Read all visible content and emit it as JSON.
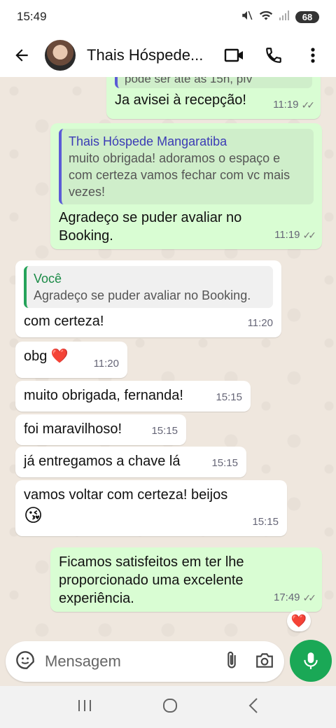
{
  "status": {
    "time": "15:49",
    "battery": "68"
  },
  "header": {
    "contact_name": "Thais Hóspede..."
  },
  "messages": [
    {
      "type": "out",
      "partial_text": "pode ser até às 15h, pfv",
      "text": "Ja avisei à recepção!",
      "time": "11:19"
    },
    {
      "type": "out",
      "quote_name": "Thais Hóspede Mangaratiba",
      "quote_text": "muito obrigada! adoramos o espaço e com certeza vamos fechar com vc mais vezes!",
      "text": "Agradeço se puder avaliar no Booking.",
      "time": "11:19"
    },
    {
      "type": "in",
      "quote_name": "Você",
      "quote_text": "Agradeço se puder avaliar no Booking.",
      "text": "com certeza!",
      "time": "11:20"
    },
    {
      "type": "in",
      "text": "obg ❤️",
      "time": "11:20"
    },
    {
      "type": "in",
      "text": "muito obrigada, fernanda!",
      "time": "15:15"
    },
    {
      "type": "in",
      "text": "foi maravilhoso!",
      "time": "15:15"
    },
    {
      "type": "in",
      "text": "já entregamos a chave lá",
      "time": "15:15"
    },
    {
      "type": "in",
      "text": "vamos voltar com certeza! beijos",
      "emoji": "😘",
      "time": "15:15"
    },
    {
      "type": "out",
      "text": "Ficamos satisfeitos em ter lhe proporcionado uma excelente experiência.",
      "time": "17:49",
      "reaction": "❤️"
    }
  ],
  "input": {
    "placeholder": "Mensagem"
  },
  "colors": {
    "outgoing": "#d9fdd3",
    "incoming": "#ffffff",
    "accent": "#1aa856",
    "background": "#efe7de"
  }
}
